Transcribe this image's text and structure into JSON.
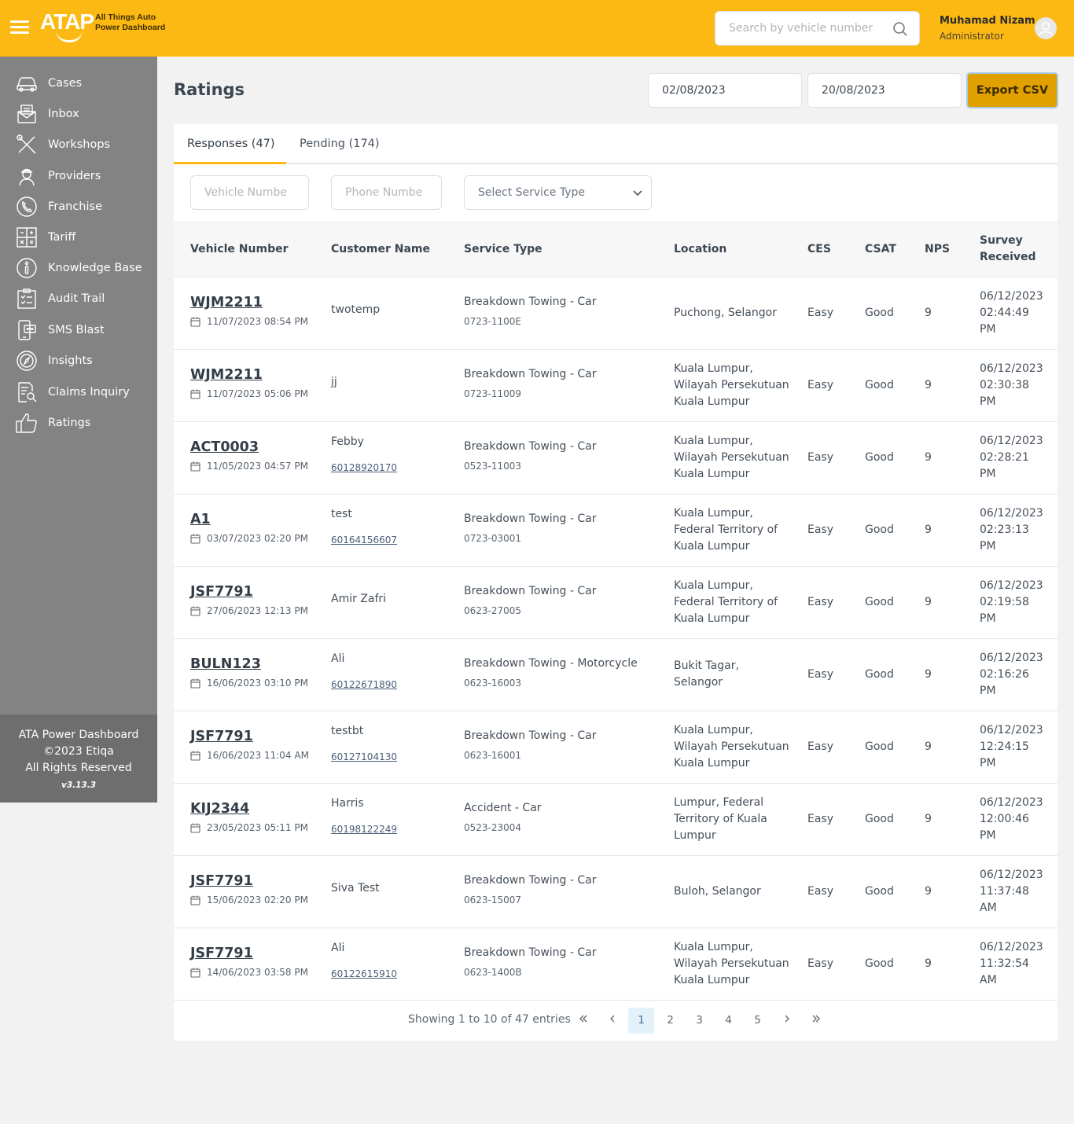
{
  "header": {
    "logo_text": "ATAP",
    "logo_sub_1": "All Things Auto",
    "logo_sub_2": "Power Dashboard",
    "search_placeholder": "Search by vehicle number",
    "user_name": "Muhamad Nizam",
    "user_role": "Administrator",
    "brand_color": "#fdb913"
  },
  "sidebar": {
    "items": [
      {
        "label": "Cases",
        "icon": "car-icon"
      },
      {
        "label": "Inbox",
        "icon": "inbox-icon"
      },
      {
        "label": "Workshops",
        "icon": "tools-icon"
      },
      {
        "label": "Providers",
        "icon": "mechanic-icon"
      },
      {
        "label": "Franchise",
        "icon": "phone-icon"
      },
      {
        "label": "Tariff",
        "icon": "calculator-icon"
      },
      {
        "label": "Knowledge Base",
        "icon": "info-icon"
      },
      {
        "label": "Audit Trail",
        "icon": "checklist-icon"
      },
      {
        "label": "SMS Blast",
        "icon": "sms-icon"
      },
      {
        "label": "Insights",
        "icon": "compass-icon"
      },
      {
        "label": "Claims Inquiry",
        "icon": "document-search-icon"
      },
      {
        "label": "Ratings",
        "icon": "thumbs-up-icon"
      }
    ],
    "footer": {
      "line1": "ATA Power Dashboard",
      "line2": "©2023 Etiqa",
      "line3": "All Rights Reserved",
      "version": "v3.13.3"
    }
  },
  "page": {
    "title": "Ratings",
    "date_from": "02/08/2023",
    "date_to": "20/08/2023",
    "export_label": "Export CSV"
  },
  "tabs": {
    "responses": "Responses (47)",
    "pending": "Pending (174)"
  },
  "filters": {
    "vehicle_placeholder": "Vehicle Numbe",
    "phone_placeholder": "Phone Numbe",
    "service_type": "Select Service Type"
  },
  "table": {
    "headers": {
      "vehicle": "Vehicle Number",
      "customer": "Customer Name",
      "service": "Service Type",
      "location": "Location",
      "ces": "CES",
      "csat": "CSAT",
      "nps": "NPS",
      "survey_1": "Survey",
      "survey_2": "Received"
    },
    "rows": [
      {
        "vehicle": "WJM2211",
        "date": "11/07/2023 08:54 PM",
        "customer": "twotemp",
        "phone": "",
        "service": "Breakdown Towing - Car",
        "code": "0723-1100E",
        "location": [
          "Puchong, Selangor"
        ],
        "ces": "Easy",
        "csat": "Good",
        "nps": "9",
        "survey": [
          "06/12/2023",
          "02:44:49",
          "PM"
        ]
      },
      {
        "vehicle": "WJM2211",
        "date": "11/07/2023 05:06 PM",
        "customer": "jj",
        "phone": "",
        "service": "Breakdown Towing - Car",
        "code": "0723-11009",
        "location": [
          "Kuala Lumpur,",
          "Wilayah Persekutuan",
          "Kuala Lumpur"
        ],
        "ces": "Easy",
        "csat": "Good",
        "nps": "9",
        "survey": [
          "06/12/2023",
          "02:30:38",
          "PM"
        ]
      },
      {
        "vehicle": "ACT0003",
        "date": "11/05/2023 04:57 PM",
        "customer": "Febby",
        "phone": "60128920170",
        "service": "Breakdown Towing - Car",
        "code": "0523-11003",
        "location": [
          "Kuala Lumpur,",
          "Wilayah Persekutuan",
          "Kuala Lumpur"
        ],
        "ces": "Easy",
        "csat": "Good",
        "nps": "9",
        "survey": [
          "06/12/2023",
          "02:28:21",
          "PM"
        ]
      },
      {
        "vehicle": "A1",
        "date": "03/07/2023 02:20 PM",
        "customer": "test",
        "phone": "60164156607",
        "service": "Breakdown Towing - Car",
        "code": "0723-03001",
        "location": [
          "Kuala Lumpur,",
          "Federal Territory of",
          "Kuala Lumpur"
        ],
        "ces": "Easy",
        "csat": "Good",
        "nps": "9",
        "survey": [
          "06/12/2023",
          "02:23:13",
          "PM"
        ]
      },
      {
        "vehicle": "JSF7791",
        "date": "27/06/2023 12:13 PM",
        "customer": "Amir Zafri",
        "phone": "",
        "service": "Breakdown Towing - Car",
        "code": "0623-27005",
        "location": [
          "Kuala Lumpur,",
          "Federal Territory of",
          "Kuala Lumpur"
        ],
        "ces": "Easy",
        "csat": "Good",
        "nps": "9",
        "survey": [
          "06/12/2023",
          "02:19:58",
          "PM"
        ]
      },
      {
        "vehicle": "BULN123",
        "date": "16/06/2023 03:10 PM",
        "customer": "Ali",
        "phone": "60122671890",
        "service": "Breakdown Towing - Motorcycle",
        "code": "0623-16003",
        "location": [
          "Bukit Tagar,",
          "Selangor"
        ],
        "ces": "Easy",
        "csat": "Good",
        "nps": "9",
        "survey": [
          "06/12/2023",
          "02:16:26",
          "PM"
        ]
      },
      {
        "vehicle": "JSF7791",
        "date": "16/06/2023 11:04 AM",
        "customer": "testbt",
        "phone": "60127104130",
        "service": "Breakdown Towing - Car",
        "code": "0623-16001",
        "location": [
          "Kuala Lumpur,",
          "Wilayah Persekutuan",
          "Kuala Lumpur"
        ],
        "ces": "Easy",
        "csat": "Good",
        "nps": "9",
        "survey": [
          "06/12/2023",
          "12:24:15",
          "PM"
        ]
      },
      {
        "vehicle": "KIJ2344",
        "date": "23/05/2023 05:11 PM",
        "customer": "Harris",
        "phone": "60198122249",
        "service": "Accident - Car",
        "code": "0523-23004",
        "location": [
          "Lumpur, Federal",
          "Territory of Kuala",
          "Lumpur"
        ],
        "ces": "Easy",
        "csat": "Good",
        "nps": "9",
        "survey": [
          "06/12/2023",
          "12:00:46",
          "PM"
        ]
      },
      {
        "vehicle": "JSF7791",
        "date": "15/06/2023 02:20 PM",
        "customer": "Siva Test",
        "phone": "",
        "service": "Breakdown Towing - Car",
        "code": "0623-15007",
        "location": [
          "Buloh, Selangor"
        ],
        "ces": "Easy",
        "csat": "Good",
        "nps": "9",
        "survey": [
          "06/12/2023",
          "11:37:48",
          "AM"
        ]
      },
      {
        "vehicle": "JSF7791",
        "date": "14/06/2023 03:58 PM",
        "customer": "Ali",
        "phone": "60122615910",
        "service": "Breakdown Towing - Car",
        "code": "0623-1400B",
        "location": [
          "Kuala Lumpur,",
          "Wilayah Persekutuan",
          "Kuala Lumpur"
        ],
        "ces": "Easy",
        "csat": "Good",
        "nps": "9",
        "survey": [
          "06/12/2023",
          "11:32:54",
          "AM"
        ]
      }
    ]
  },
  "pagination": {
    "info": "Showing 1 to 10 of 47 entries",
    "first": "«",
    "prev": "‹",
    "pages": [
      "1",
      "2",
      "3",
      "4",
      "5"
    ],
    "current": "1",
    "next": "›",
    "last": "»"
  }
}
